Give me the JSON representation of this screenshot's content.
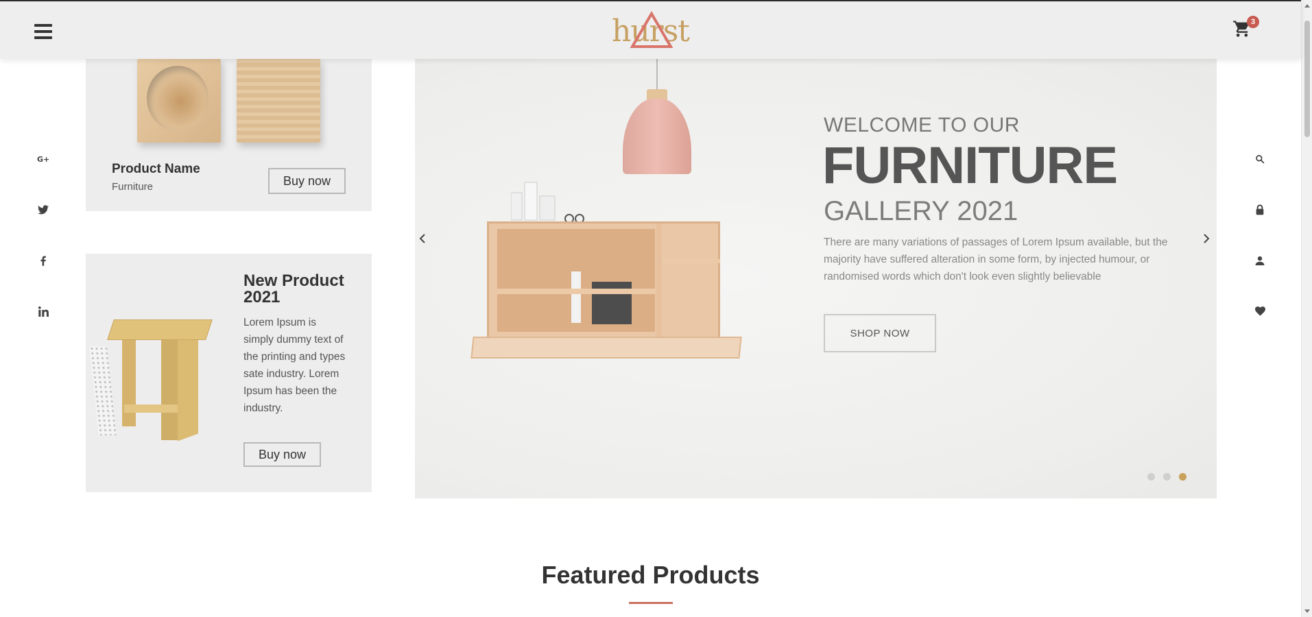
{
  "header": {
    "logo_text": "hurst",
    "cart_count": "3"
  },
  "social": [
    "google-plus-icon",
    "twitter-icon",
    "facebook-icon",
    "linkedin-icon"
  ],
  "right_icons": [
    "search-icon",
    "lock-icon",
    "user-icon",
    "heart-icon"
  ],
  "card1": {
    "name": "Product Name",
    "category": "Furniture",
    "button": "Buy now"
  },
  "card2": {
    "title": "New Product 2021",
    "description": "Lorem Ipsum is simply dummy text of the printing and types sate industry. Lorem Ipsum has been the industry.",
    "button": "Buy now"
  },
  "hero": {
    "line1": "WELCOME TO OUR",
    "line2": "FURNITURE",
    "line3": "GALLERY 2021",
    "description": "There are many variations of passages of Lorem Ipsum available, but the majority have suffered alteration in some form, by injected humour, or randomised words which don't look even slightly believable",
    "button": "SHOP NOW",
    "slides": 3,
    "active_slide": 3
  },
  "featured": {
    "title": "Featured Products"
  },
  "colors": {
    "accent_gold": "#c8a15a",
    "accent_red": "#c85b50",
    "header_bg": "#eeeeee"
  }
}
